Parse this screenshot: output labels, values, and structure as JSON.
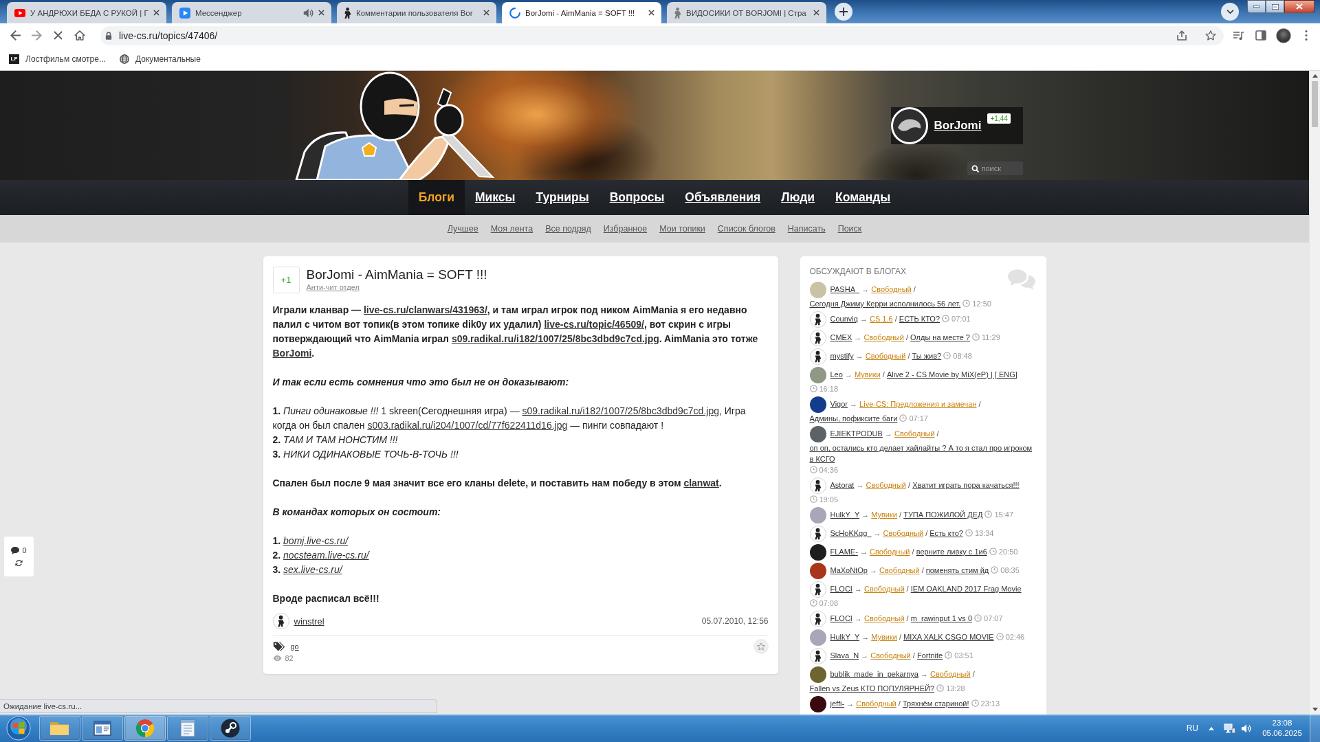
{
  "browser": {
    "tabs": [
      {
        "kind": "video",
        "title": "У АНДРЮХИ БЕДА С РУКОЙ | Г",
        "audio": false,
        "selected": false
      },
      {
        "kind": "messenger",
        "title": "Мессенджер",
        "audio": true,
        "selected": false
      },
      {
        "kind": "figure",
        "title": "Комментарии пользователя Bor",
        "audio": false,
        "selected": false
      },
      {
        "kind": "spinner",
        "title": "BorJomi - AimMania = SOFT !!!",
        "audio": false,
        "selected": true
      },
      {
        "kind": "figure_light",
        "title": "ВИДОСИКИ ОТ BORJOMI | Стра",
        "audio": false,
        "selected": false
      }
    ],
    "loading": true,
    "url": "live-cs.ru/topics/47406/",
    "bookmarks": [
      {
        "kind": "lettermark",
        "mark": "LF",
        "label": "Лостфильм смотре..."
      },
      {
        "kind": "globe",
        "label": "Документальные"
      }
    ],
    "status": "Ожидание live-cs.ru..."
  },
  "site": {
    "user": {
      "name": "BorJomi",
      "rating": "+1,44"
    },
    "search": {
      "placeholder": "поиск"
    },
    "nav": [
      {
        "label": "Блоги",
        "selected": true
      },
      {
        "label": "Миксы",
        "selected": false
      },
      {
        "label": "Турниры",
        "selected": false
      },
      {
        "label": "Вопросы",
        "selected": false
      },
      {
        "label": "Объявления",
        "selected": false
      },
      {
        "label": "Люди",
        "selected": false
      },
      {
        "label": "Команды",
        "selected": false
      }
    ],
    "subnav": [
      "Лучшее",
      "Моя лента",
      "Все подряд",
      "Избранное",
      "Мои топики",
      "Список блогов",
      "Написать",
      "Поиск"
    ]
  },
  "post": {
    "votes": "+1",
    "title": "BorJomi - AimMania = SOFT !!!",
    "blog": "Анти-чит отдел",
    "body": [
      {
        "kind": "bold_paragraph",
        "parts": [
          {
            "kind": "text",
            "text": "Играли кланвар — "
          },
          {
            "kind": "link",
            "text": "live-cs.ru/clanwars/431963/"
          },
          {
            "kind": "text",
            "text": ", и там играл игрок под ником AimMania я его недавно палил с читом вот топик(в этом топике dik0y их удалил) "
          },
          {
            "kind": "link",
            "text": "live-cs.ru/topic/46509/"
          },
          {
            "kind": "text",
            "text": ", вот скрин с игры потверждающий что AimMania играл "
          },
          {
            "kind": "link",
            "text": "s09.radikal.ru/i182/1007/25/8bc3dbd9c7cd.jpg"
          },
          {
            "kind": "text",
            "text": ". AimMania это тотже "
          },
          {
            "kind": "link",
            "text": "BorJomi"
          },
          {
            "kind": "text",
            "text": "."
          }
        ]
      },
      {
        "kind": "bold_italic_paragraph",
        "parts": [
          {
            "kind": "text",
            "text": "И так если есть сомнения что это был не он доказывают:"
          }
        ]
      },
      {
        "kind": "list",
        "items": [
          [
            {
              "kind": "text",
              "text": "**1.** *Пинги одинаковые !!!* 1 skreen(Сегоднешняя игра) — "
            },
            {
              "kind": "link",
              "text": "s09.radikal.ru/i182/1007/25/8bc3dbd9c7cd.jpg"
            },
            {
              "kind": "text",
              "text": ", Игра когда он был спален "
            },
            {
              "kind": "link",
              "text": "s003.radikal.ru/i204/1007/cd/77f622411d16.jpg"
            },
            {
              "kind": "text",
              "text": " — пинги совпадают !"
            }
          ],
          [
            {
              "kind": "text",
              "text": "**2.** *ТАМ И ТАМ НОНСТИМ !!!*"
            }
          ],
          [
            {
              "kind": "text",
              "text": "**3.** *НИКИ ОДИНАКОВЫЕ ТОЧЬ-В-ТОЧЬ !!!*"
            }
          ]
        ]
      },
      {
        "kind": "bold_paragraph",
        "parts": [
          {
            "kind": "text",
            "text": "Спален был после 9 мая значит все его кланы delete, и поставить нам победу в этом "
          },
          {
            "kind": "link",
            "text": "clanwat"
          },
          {
            "kind": "text",
            "text": "."
          }
        ]
      },
      {
        "kind": "bold_italic_paragraph",
        "parts": [
          {
            "kind": "text",
            "text": "В командах которых он состоит:"
          }
        ]
      },
      {
        "kind": "list",
        "items": [
          [
            {
              "kind": "text",
              "text": "**1.** "
            },
            {
              "kind": "italic_link",
              "text": "bomj.live-cs.ru/"
            }
          ],
          [
            {
              "kind": "text",
              "text": "**2.** "
            },
            {
              "kind": "italic_link",
              "text": "nocsteam.live-cs.ru/"
            }
          ],
          [
            {
              "kind": "text",
              "text": "**3.** "
            },
            {
              "kind": "italic_link",
              "text": "sex.live-cs.ru/"
            }
          ]
        ]
      },
      {
        "kind": "bold_paragraph",
        "parts": [
          {
            "kind": "text",
            "text": "Вроде расписал всё!!!"
          }
        ]
      }
    ],
    "author": {
      "name": "winstrel",
      "avatar": {
        "kind": "default"
      }
    },
    "date": "05.07.2010, 12:56",
    "tags": [
      "go"
    ],
    "views": "82",
    "favourite": false
  },
  "sidebar": {
    "title": "ОБСУЖДАЮТ В БЛОГАХ",
    "items": [
      {
        "avatar": {
          "kind": "photo",
          "color": "#c8c3a6"
        },
        "user": "PASHA_",
        "arrow": "→",
        "blog": "Свободный",
        "sep": "/",
        "topic": "Сегодня Джиму Керри исполнилось 56 лет.",
        "time": "12:50"
      },
      {
        "avatar": {
          "kind": "default"
        },
        "user": "Counviq",
        "arrow": "→",
        "blog": "CS 1.6",
        "sep": "/",
        "topic": "ЕСТЬ КТО?",
        "time": "07:01"
      },
      {
        "avatar": {
          "kind": "default"
        },
        "user": "CMEX",
        "arrow": "→",
        "blog": "Свободный",
        "sep": "/",
        "topic": "Олды на месте ?",
        "time": "11:29"
      },
      {
        "avatar": {
          "kind": "default"
        },
        "user": "mystify",
        "arrow": "→",
        "blog": "Свободный",
        "sep": "/",
        "topic": "Ты жив?",
        "time": "08:48"
      },
      {
        "avatar": {
          "kind": "photo",
          "color": "#8e9884"
        },
        "user": "Leo",
        "arrow": "→",
        "blog": "Мувики",
        "sep": "/",
        "topic": "Alive 2 - CS Movie by MiX(eP) | [ ENG]",
        "time": "16:18"
      },
      {
        "avatar": {
          "kind": "photo",
          "color": "#143c8c"
        },
        "user": "Vigor",
        "arrow": "→",
        "blog": "Live-CS: Предложения и замечан",
        "sep": "/",
        "topic": "Админы, пофиксите баги",
        "time": "07:17"
      },
      {
        "avatar": {
          "kind": "photo",
          "color": "#5c6266"
        },
        "user": "EJIEKTPODUB",
        "arrow": "→",
        "blog": "Свободный",
        "sep": "/",
        "topic": "оп оп, остались кто делает хайлайты ? А то я стал про игроком в КСГО",
        "time": "04:36"
      },
      {
        "avatar": {
          "kind": "default"
        },
        "user": "Astorat",
        "arrow": "→",
        "blog": "Свободный",
        "sep": "/",
        "topic": "Хватит играть пора качаться!!!",
        "time": "19:05"
      },
      {
        "avatar": {
          "kind": "photo",
          "color": "#aaa6b8"
        },
        "user": "HulkY_Y",
        "arrow": "→",
        "blog": "Мувики",
        "sep": "/",
        "topic": "ТУПА ПОЖИЛОЙ ДЕД",
        "time": "15:47"
      },
      {
        "avatar": {
          "kind": "default"
        },
        "user": "ScHoKKgg_",
        "arrow": "→",
        "blog": "Свободный",
        "sep": "/",
        "topic": "Есть кто?",
        "time": "13:34"
      },
      {
        "avatar": {
          "kind": "photo",
          "color": "#1e1e1e"
        },
        "user": "FLAME-",
        "arrow": "→",
        "blog": "Свободный",
        "sep": "/",
        "topic": "верните ливку с 1и6",
        "time": "20:50"
      },
      {
        "avatar": {
          "kind": "photo",
          "color": "#a8361a"
        },
        "user": "MaXoNtOp",
        "arrow": "→",
        "blog": "Свободный",
        "sep": "/",
        "topic": "поменять стим йд",
        "time": "08:35"
      },
      {
        "avatar": {
          "kind": "default"
        },
        "user": "FLOCI",
        "arrow": "→",
        "blog": "Свободный",
        "sep": "/",
        "topic": "IEM OAKLAND 2017 Frag Movie",
        "time": "07:08"
      },
      {
        "avatar": {
          "kind": "default"
        },
        "user": "FLOCI",
        "arrow": "→",
        "blog": "Свободный",
        "sep": "/",
        "topic": "m_rawinput 1 vs 0",
        "time": "07:07"
      },
      {
        "avatar": {
          "kind": "photo",
          "color": "#aaa6b8"
        },
        "user": "HulkY_Y",
        "arrow": "→",
        "blog": "Мувики",
        "sep": "/",
        "topic": "MIXA XALK CSGO MOVIE",
        "time": "02:46"
      },
      {
        "avatar": {
          "kind": "default"
        },
        "user": "Slava_N",
        "arrow": "→",
        "blog": "Свободный",
        "sep": "/",
        "topic": "Fortnite",
        "time": "03:51"
      },
      {
        "avatar": {
          "kind": "photo",
          "color": "#6e6430"
        },
        "user": "bublik_made_in_pekarnya",
        "arrow": "→",
        "blog": "Свободный",
        "sep": "/",
        "topic": "Fallen vs Zeus КТО ПОПУЛЯРНЕЙ?",
        "time": "13:28"
      },
      {
        "avatar": {
          "kind": "photo",
          "color": "#3a0810"
        },
        "user": "jeffi-",
        "arrow": "→",
        "blog": "Свободный",
        "sep": "/",
        "topic": "Тряхнём стариной!",
        "time": "23:13"
      }
    ]
  },
  "widget": {
    "comments": "0"
  },
  "taskbar": {
    "apps": [
      {
        "kind": "folder",
        "selected": false
      },
      {
        "kind": "window",
        "selected": false
      },
      {
        "kind": "browser",
        "selected": true
      },
      {
        "kind": "notepad",
        "selected": false
      },
      {
        "kind": "steam",
        "selected": false
      }
    ],
    "language": "RU",
    "time": "23:08",
    "date": "05.06.2025"
  }
}
